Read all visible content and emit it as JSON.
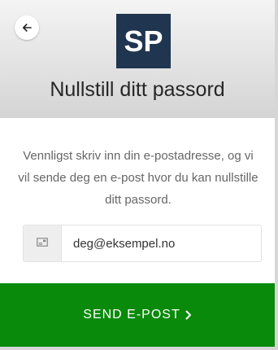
{
  "header": {
    "back_icon": "arrow-left-icon",
    "logo_text": "SP",
    "logo_color": "#1f3550",
    "title": "Nullstill ditt passord"
  },
  "form": {
    "instructions": "Vennligst skriv inn din e-postadresse, og vi vil sende deg en e-post hvor du kan nullstille ditt passord.",
    "email_icon": "envelope-icon",
    "email_value": "deg@eksempel.no",
    "submit_label": "SEND E-POST",
    "submit_icon": "chevron-right-icon",
    "submit_color": "#0a8a0a"
  }
}
